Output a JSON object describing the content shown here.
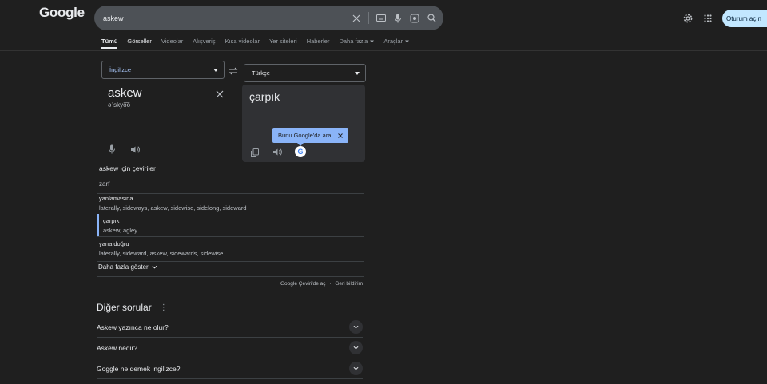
{
  "header": {
    "logo": "Google",
    "search_value": "askew",
    "signin_label": "Oturum açın"
  },
  "tabs": [
    {
      "label": "Tümü"
    },
    {
      "label": "Görseller"
    },
    {
      "label": "Videolar"
    },
    {
      "label": "Alışveriş"
    },
    {
      "label": "Kısa videolar"
    },
    {
      "label": "Yer siteleri"
    },
    {
      "label": "Haberler"
    },
    {
      "label": "Daha fazla"
    },
    {
      "label": "Araçlar"
    }
  ],
  "translate": {
    "source_lang": "İngilizce",
    "target_lang": "Türkçe",
    "source_word": "askew",
    "phonetic": "əˈskyo͞o",
    "target_word": "çarpık",
    "tooltip": "Bunu Google'da ara"
  },
  "dictionary": {
    "title": "askew için çeviriler",
    "part_of_speech": "zarf",
    "entries": [
      {
        "word": "yanlamasına",
        "synonyms": "laterally, sideways, askew, sidewise, sidelong, sideward"
      },
      {
        "word": "çarpık",
        "synonyms": "askew, agley"
      },
      {
        "word": "yana doğru",
        "synonyms": "laterally, sideward, askew, sidewards, sidewise"
      }
    ],
    "show_more": "Daha fazla göster",
    "open_translate": "Google Çeviri'de aç",
    "feedback": "Geri bildirim",
    "separator": "·"
  },
  "other_questions": {
    "title": "Diğer sorular",
    "items": [
      {
        "q": "Askew yazınca ne olur?"
      },
      {
        "q": "Askew nedir?"
      },
      {
        "q": "Goggle ne demek ingilizce?"
      }
    ]
  },
  "colors": {
    "background": "#1f1f1f",
    "accent": "#8ab4f8",
    "signin_bg": "#c2e7ff"
  }
}
